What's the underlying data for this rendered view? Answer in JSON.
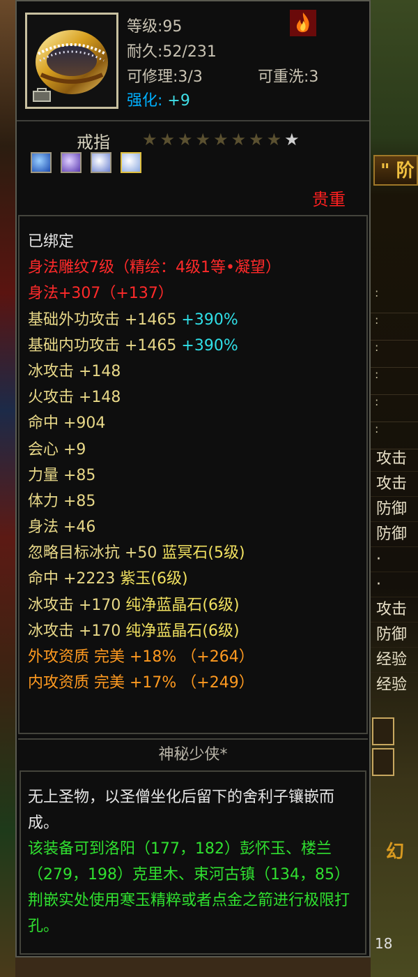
{
  "item": {
    "level": "等级:95",
    "durability": "耐久:52/231",
    "repair": "可修理:3/3",
    "rewash": "可重洗:3",
    "enhance_label": "强化:",
    "enhance_value": "+9",
    "type": "戒指",
    "stars_total": 9,
    "stars_lit": 1,
    "rarity": "贵重",
    "gems": [
      {
        "name": "blue-gem",
        "color": "#2a6ad8"
      },
      {
        "name": "purple-gem",
        "color": "#7a5ad0"
      },
      {
        "name": "crystal-gem",
        "color": "#a0c0ff"
      },
      {
        "name": "crystal-gem",
        "color": "#c0d8ff"
      }
    ]
  },
  "attributes": {
    "bound": "已绑定",
    "engrave": "身法雕纹7级（精绘：4级1等•凝望）",
    "agility_main": "身法+307（+137）",
    "phys_atk": "基础外功攻击 +1465",
    "phys_atk_pct": "+390%",
    "mag_atk": "基础内功攻击 +1465",
    "mag_atk_pct": "+390%",
    "ice_atk": "冰攻击 +148",
    "fire_atk": "火攻击 +148",
    "hit": "命中 +904",
    "crit": "会心 +9",
    "strength": "力量 +85",
    "stamina": "体力 +85",
    "agility": "身法 +46",
    "gem1_stat": "忽略目标冰抗 +50 ",
    "gem1_name": "蓝冥石(5级)",
    "gem2_stat": "命中 +2223 ",
    "gem2_name": "紫玉(6级)",
    "gem3_stat": "冰攻击 +170 ",
    "gem3_name": "纯净蓝晶石(6级)",
    "gem4_stat": "冰攻击 +170 ",
    "gem4_name": "纯净蓝晶石(6级)",
    "qual_phys": "外攻资质  完美 +18% （+264）",
    "qual_mag": "内攻资质  完美 +17% （+249）"
  },
  "owner": "神秘少侠*",
  "description": {
    "lore": "无上圣物，以圣僧坐化后留下的舍利子镶嵌而成。",
    "hint": "该装备可到洛阳（177，182）彭怀玉、楼兰（279，198）克里木、束河古镇（134，85）荆嵌实处使用寒玉精粹或者点金之箭进行极限打孔。"
  },
  "background": {
    "tab_label": "\" 阶",
    "right_rows": [
      "攻击",
      "攻击",
      "防御",
      "防御",
      "·",
      "·",
      "攻击",
      "防御",
      "经验",
      "经验"
    ],
    "dot_rows": [
      ":",
      ":",
      ":",
      ":",
      ":",
      ":"
    ],
    "xiyou": "幻",
    "bottom_num": "18"
  },
  "colors": {
    "panel_bg": "#0e0e0e",
    "red": "#ff2a2a",
    "gold": "#e8d888",
    "cyan": "#30e0e8",
    "orange": "#ff9a20",
    "green": "#30e030"
  }
}
